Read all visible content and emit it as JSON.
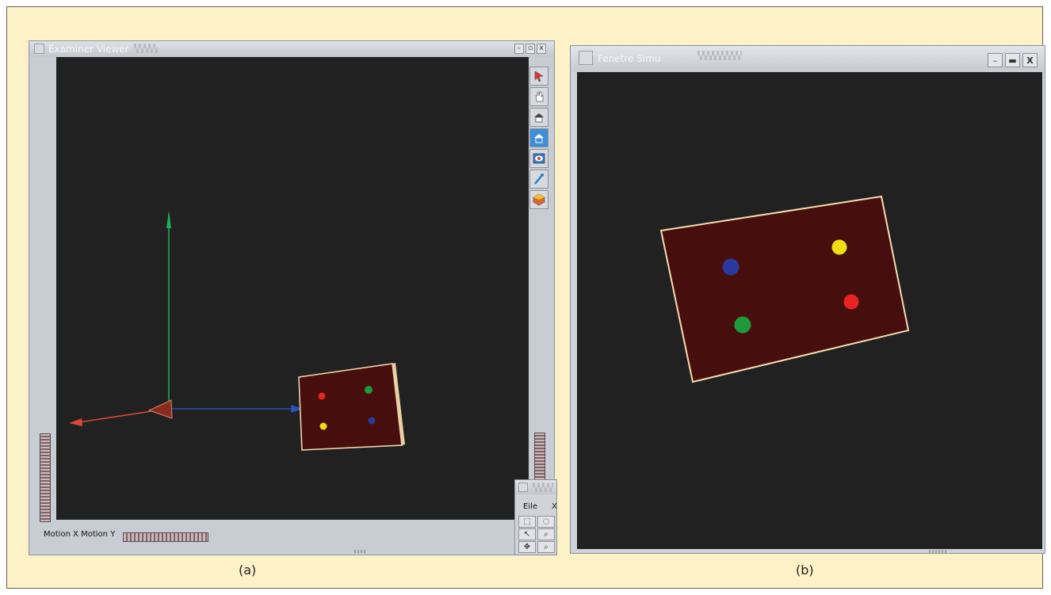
{
  "captions": {
    "a": "(a)",
    "b": "(b)"
  },
  "examiner_window": {
    "title": "Examiner Viewer",
    "minimize_label": "–",
    "maximize_label": "▫",
    "close_label": "x",
    "motion_label": "Motion X Motion Y",
    "toolbar_icons": [
      "pick-arrow-icon",
      "hand-icon",
      "home-icon",
      "set-home-icon",
      "view-all-icon",
      "seek-icon",
      "projection-icon"
    ]
  },
  "small_window": {
    "menu_file": "Eile",
    "menu_next": "X"
  },
  "simu_window": {
    "title": "Fenetre Simu",
    "minimize_label": "–",
    "maximize_label": "▬",
    "close_label": "X"
  },
  "colors": {
    "background": "#fdf1c8",
    "viewport": "#212121",
    "board": "#470e0e",
    "axis_x": "#d84a35",
    "axis_y": "#1fae55",
    "axis_z": "#2c4fb8",
    "dot_red": "#e82323",
    "dot_green": "#1e9a3c",
    "dot_blue": "#2a3a9c",
    "dot_yellow": "#f2dd12"
  }
}
